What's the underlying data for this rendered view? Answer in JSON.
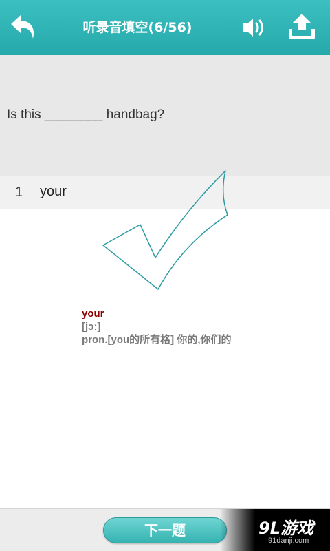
{
  "header": {
    "title": "听录音填空(6/56)",
    "back_icon": "back-arrow-icon",
    "audio_icon": "speaker-icon",
    "upload_icon": "upload-icon",
    "background_color": "#2fb4b6"
  },
  "question": {
    "text": "Is this ________ handbag?"
  },
  "answer": {
    "number": "1",
    "value": "your",
    "result_icon": "check-mark-icon"
  },
  "definition": {
    "word": "your",
    "phonetic": "[jɔ:]",
    "meaning": "pron.[you的所有格] 你的,你们的",
    "word_color": "#8b0000"
  },
  "footer": {
    "next_label": "下一题",
    "watermark_logo": "9L游戏",
    "watermark_url": "91danji.com"
  }
}
